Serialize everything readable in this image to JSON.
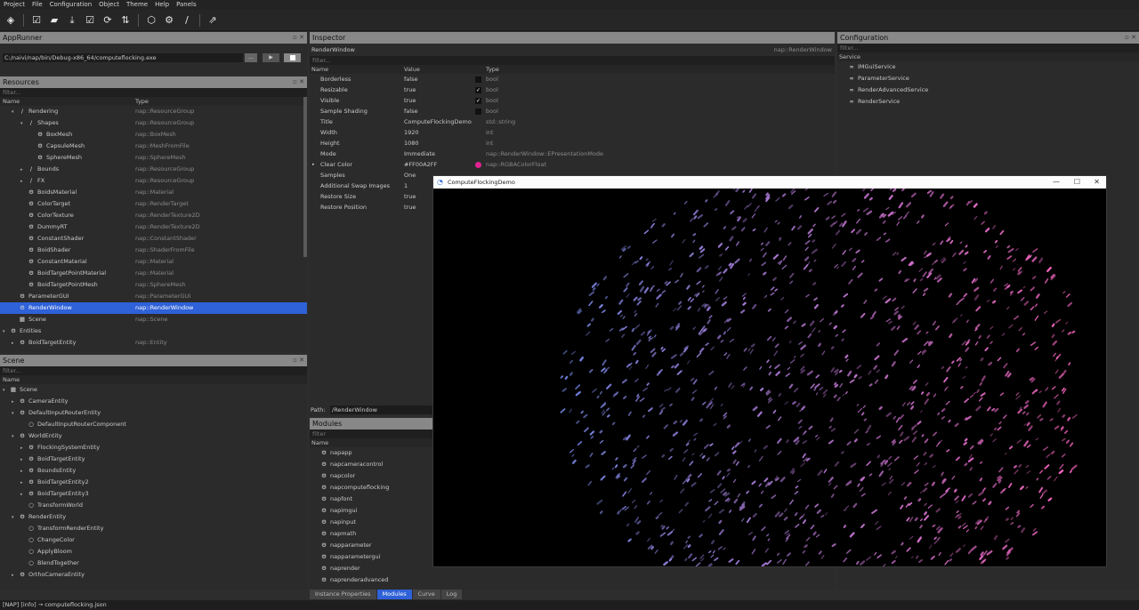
{
  "menu": [
    "Project",
    "File",
    "Configuration",
    "Object",
    "Theme",
    "Help",
    "Panels"
  ],
  "toolbar": {
    "icons": [
      "nap-logo-icon",
      "new-file-icon",
      "open-folder-icon",
      "download-icon",
      "save-icon",
      "reload-icon",
      "sort-icon",
      "cube-icon",
      "settings-icon",
      "slash-icon",
      "external-icon"
    ]
  },
  "apprunner": {
    "title": "AppRunner",
    "path": "C:/naivi/nap/bin/Debug-x86_64/computeflocking.exe",
    "browse": "..."
  },
  "resources": {
    "title": "Resources",
    "filter": "filter...",
    "col_name": "Name",
    "col_type": "Type",
    "rows": [
      {
        "name": "Rendering",
        "type": "nap::ResourceGroup",
        "indent": 1,
        "arrow": "▾",
        "icon": "/"
      },
      {
        "name": "Shapes",
        "type": "nap::ResourceGroup",
        "indent": 2,
        "arrow": "▾",
        "icon": "/"
      },
      {
        "name": "BoxMesh",
        "type": "nap::BoxMesh",
        "indent": 3,
        "arrow": "",
        "icon": "⚙"
      },
      {
        "name": "CapsuleMesh",
        "type": "nap::MeshFromFile",
        "indent": 3,
        "arrow": "",
        "icon": "⚙"
      },
      {
        "name": "SphereMesh",
        "type": "nap::SphereMesh",
        "indent": 3,
        "arrow": "",
        "icon": "⚙"
      },
      {
        "name": "Bounds",
        "type": "nap::ResourceGroup",
        "indent": 2,
        "arrow": "▸",
        "icon": "/"
      },
      {
        "name": "FX",
        "type": "nap::ResourceGroup",
        "indent": 2,
        "arrow": "▸",
        "icon": "/"
      },
      {
        "name": "BoidsMaterial",
        "type": "nap::Material",
        "indent": 2,
        "arrow": "",
        "icon": "⚙"
      },
      {
        "name": "ColorTarget",
        "type": "nap::RenderTarget",
        "indent": 2,
        "arrow": "",
        "icon": "⚙"
      },
      {
        "name": "ColorTexture",
        "type": "nap::RenderTexture2D",
        "indent": 2,
        "arrow": "",
        "icon": "⚙"
      },
      {
        "name": "DummyRT",
        "type": "nap::RenderTexture2D",
        "indent": 2,
        "arrow": "",
        "icon": "⚙"
      },
      {
        "name": "ConstantShader",
        "type": "nap::ConstantShader",
        "indent": 2,
        "arrow": "",
        "icon": "⚙"
      },
      {
        "name": "BoidShader",
        "type": "nap::ShaderFromFile",
        "indent": 2,
        "arrow": "",
        "icon": "⚙"
      },
      {
        "name": "ConstantMaterial",
        "type": "nap::Material",
        "indent": 2,
        "arrow": "",
        "icon": "⚙"
      },
      {
        "name": "BoidTargetPointMaterial",
        "type": "nap::Material",
        "indent": 2,
        "arrow": "",
        "icon": "⚙"
      },
      {
        "name": "BoidTargetPointMesh",
        "type": "nap::SphereMesh",
        "indent": 2,
        "arrow": "",
        "icon": "⚙"
      },
      {
        "name": "ParameterGUI",
        "type": "nap::ParameterGUI",
        "indent": 1,
        "arrow": "",
        "icon": "⚙"
      },
      {
        "name": "RenderWindow",
        "type": "nap::RenderWindow",
        "indent": 1,
        "arrow": "",
        "icon": "⚙",
        "selected": true
      },
      {
        "name": "Scene",
        "type": "nap::Scene",
        "indent": 1,
        "arrow": "",
        "icon": "▦"
      },
      {
        "name": "Entities",
        "type": "",
        "indent": 0,
        "arrow": "▾",
        "icon": "⚙"
      },
      {
        "name": "BoidTargetEntity",
        "type": "nap::Entity",
        "indent": 1,
        "arrow": "▸",
        "icon": "⚙"
      }
    ]
  },
  "scene": {
    "title": "Scene",
    "filter": "filter...",
    "col_name": "Name",
    "rows": [
      {
        "name": "Scene",
        "indent": 0,
        "arrow": "▾",
        "icon": "▦"
      },
      {
        "name": "CameraEntity",
        "indent": 1,
        "arrow": "▸",
        "icon": "⚙"
      },
      {
        "name": "DefaultInputRouterEntity",
        "indent": 1,
        "arrow": "▾",
        "icon": "⚙"
      },
      {
        "name": "DefaultInputRouterComponent",
        "indent": 2,
        "arrow": "",
        "icon": "○"
      },
      {
        "name": "WorldEntity",
        "indent": 1,
        "arrow": "▾",
        "icon": "⚙"
      },
      {
        "name": "FlockingSystemEntity",
        "indent": 2,
        "arrow": "▸",
        "icon": "⚙"
      },
      {
        "name": "BoidTargetEntity",
        "indent": 2,
        "arrow": "▸",
        "icon": "⚙"
      },
      {
        "name": "BoundsEntity",
        "indent": 2,
        "arrow": "▸",
        "icon": "⚙"
      },
      {
        "name": "BoidTargetEntity2",
        "indent": 2,
        "arrow": "▸",
        "icon": "⚙"
      },
      {
        "name": "BoidTargetEntity3",
        "indent": 2,
        "arrow": "▸",
        "icon": "⚙"
      },
      {
        "name": "TransformWorld",
        "indent": 2,
        "arrow": "",
        "icon": "○"
      },
      {
        "name": "RenderEntity",
        "indent": 1,
        "arrow": "▾",
        "icon": "⚙"
      },
      {
        "name": "TransformRenderEntity",
        "indent": 2,
        "arrow": "",
        "icon": "○"
      },
      {
        "name": "ChangeColor",
        "indent": 2,
        "arrow": "",
        "icon": "○"
      },
      {
        "name": "ApplyBloom",
        "indent": 2,
        "arrow": "",
        "icon": "○"
      },
      {
        "name": "BlendTogether",
        "indent": 2,
        "arrow": "",
        "icon": "○"
      },
      {
        "name": "OrthoCameraEntity",
        "indent": 1,
        "arrow": "▸",
        "icon": "⚙"
      }
    ]
  },
  "inspector": {
    "title": "Inspector",
    "object": "RenderWindow",
    "object_type": "nap::RenderWindow",
    "filter": "filter...",
    "col_name": "Name",
    "col_value": "Value",
    "col_type": "Type",
    "rows": [
      {
        "name": "Borderless",
        "value": "false",
        "type": "bool",
        "check": "off"
      },
      {
        "name": "Resizable",
        "value": "true",
        "type": "bool",
        "check": "on"
      },
      {
        "name": "Visible",
        "value": "true",
        "type": "bool",
        "check": "on"
      },
      {
        "name": "Sample Shading",
        "value": "false",
        "type": "bool",
        "check": "off"
      },
      {
        "name": "Title",
        "value": "ComputeFlockingDemo",
        "type": "std::string"
      },
      {
        "name": "Width",
        "value": "1920",
        "type": "int"
      },
      {
        "name": "Height",
        "value": "1080",
        "type": "int"
      },
      {
        "name": "Mode",
        "value": "Immediate",
        "type": "nap::RenderWindow::EPresentationMode"
      },
      {
        "name": "Clear Color",
        "value": "#FF00A2FF",
        "type": "nap::RGBAColorFloat",
        "swatch": "#e0238f",
        "arrow": "▸"
      },
      {
        "name": "Samples",
        "value": "One",
        "type": ""
      },
      {
        "name": "Additional Swap Images",
        "value": "1",
        "type": ""
      },
      {
        "name": "Restore Size",
        "value": "true",
        "type": ""
      },
      {
        "name": "Restore Position",
        "value": "true",
        "type": ""
      }
    ],
    "path_label": "Path:",
    "path_value": "/RenderWindow"
  },
  "modules": {
    "title": "Modules",
    "filter": "filter",
    "col_name": "Name",
    "items": [
      "napapp",
      "napcameracontrol",
      "napcolor",
      "napcomputeflocking",
      "napfont",
      "napimgui",
      "napinput",
      "napmath",
      "napparameter",
      "napparametergui",
      "naprender",
      "naprenderadvanced"
    ]
  },
  "tabs": [
    "Instance Properties",
    "Modules",
    "Curve",
    "Log"
  ],
  "active_tab": "Modules",
  "configuration": {
    "title": "Configuration",
    "filter": "filter...",
    "col": "Service",
    "items": [
      "IMGuiService",
      "ParameterService",
      "RenderAdvancedService",
      "RenderService"
    ]
  },
  "game": {
    "title": "ComputeFlockingDemo",
    "min": "—",
    "max": "☐",
    "close": "✕"
  },
  "status": "[NAP] [info] → computeflocking.json"
}
